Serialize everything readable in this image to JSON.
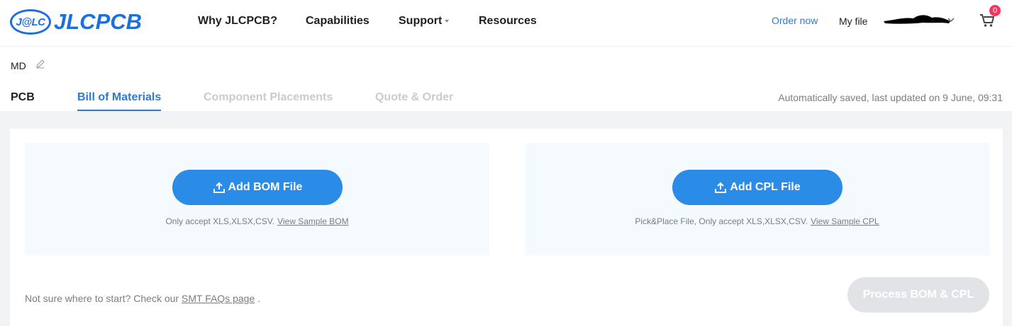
{
  "header": {
    "logo_badge": "J@LC",
    "logo_text": "JLCPCB",
    "nav": [
      {
        "label": "Why JLCPCB?"
      },
      {
        "label": "Capabilities"
      },
      {
        "label": "Support"
      },
      {
        "label": "Resources"
      }
    ],
    "order_now": "Order now",
    "my_file": "My file",
    "cart_count": "0"
  },
  "project": {
    "name": "MD"
  },
  "tabs": [
    {
      "label": "PCB",
      "state": "normal"
    },
    {
      "label": "Bill of Materials",
      "state": "active"
    },
    {
      "label": "Component Placements",
      "state": "disabled"
    },
    {
      "label": "Quote & Order",
      "state": "disabled"
    }
  ],
  "status": {
    "saved": "Automatically saved, last updated on 9 June, 09:31"
  },
  "bom_panel": {
    "button_label": "Add BOM File",
    "note": "Only accept XLS,XLSX,CSV.",
    "link": "View Sample BOM"
  },
  "cpl_panel": {
    "button_label": "Add CPL File",
    "note": "Pick&Place File, Only accept XLS,XLSX,CSV.",
    "link": "View Sample CPL"
  },
  "footer": {
    "faq_prefix": "Not sure where to start? Check our",
    "faq_link": "SMT FAQs page",
    "faq_suffix": ".",
    "process_button": "Process BOM & CPL"
  },
  "colors": {
    "brand": "#1e6fdc",
    "accent": "#2b8ce8",
    "active_tab": "#2b7ad4",
    "disabled_text": "#c9cbd0",
    "badge": "#f5365c"
  }
}
